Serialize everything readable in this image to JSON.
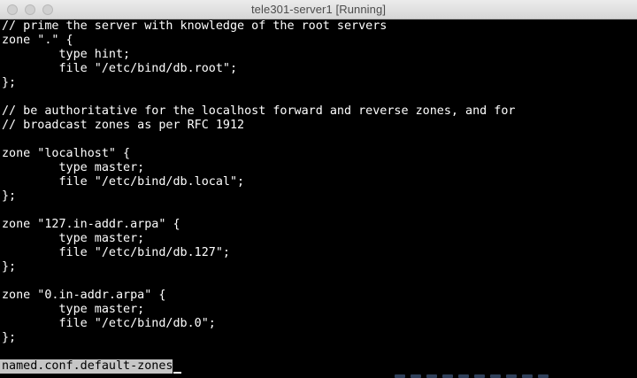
{
  "window": {
    "title": "tele301-server1 [Running]"
  },
  "terminal": {
    "lines": [
      "// prime the server with knowledge of the root servers",
      "zone \".\" {",
      "        type hint;",
      "        file \"/etc/bind/db.root\";",
      "};",
      "",
      "// be authoritative for the localhost forward and reverse zones, and for",
      "// broadcast zones as per RFC 1912",
      "",
      "zone \"localhost\" {",
      "        type master;",
      "        file \"/etc/bind/db.local\";",
      "};",
      "",
      "zone \"127.in-addr.arpa\" {",
      "        type master;",
      "        file \"/etc/bind/db.127\";",
      "};",
      "",
      "zone \"0.in-addr.arpa\" {",
      "        type master;",
      "        file \"/etc/bind/db.0\";",
      "};"
    ],
    "status_filename": "named.conf.default-zones"
  },
  "colors": {
    "terminal_background": "#000000",
    "terminal_foreground": "#ffffff",
    "statusline_background": "#c6c6c6"
  },
  "icons": {
    "close": "close-icon",
    "minimize": "minimize-icon",
    "zoom": "zoom-icon"
  }
}
